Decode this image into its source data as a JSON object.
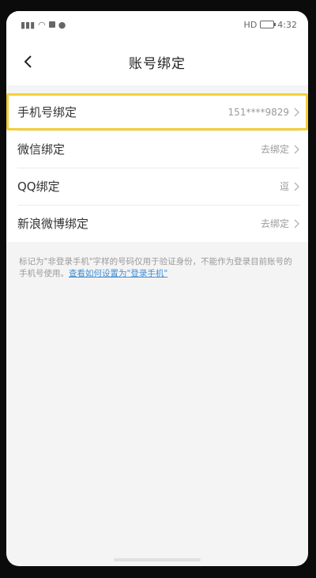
{
  "status_bar": {
    "time": "4:32",
    "hd_badge": "HD",
    "icons_left": [
      "signal-icon",
      "wifi-icon",
      "notification-icon",
      "message-icon"
    ],
    "icons_right": [
      "hd-icon",
      "battery-icon"
    ]
  },
  "header": {
    "title": "账号绑定",
    "back_icon": "chevron-left-icon"
  },
  "bindings": [
    {
      "label": "手机号绑定",
      "value": "151****9829",
      "highlighted": true
    },
    {
      "label": "微信绑定",
      "value": "去绑定",
      "highlighted": false
    },
    {
      "label": "QQ绑定",
      "value": "逗",
      "highlighted": false
    },
    {
      "label": "新浪微博绑定",
      "value": "去绑定",
      "highlighted": false
    }
  ],
  "note": {
    "text": "标记为\"非登录手机\"字样的号码仅用于验证身份，不能作为登录目前账号的手机号使用。",
    "link": "查看如何设置为\"登录手机\""
  },
  "colors": {
    "highlight": "#f4cf3a",
    "link": "#3f8fd6",
    "background": "#f4f4f4"
  }
}
